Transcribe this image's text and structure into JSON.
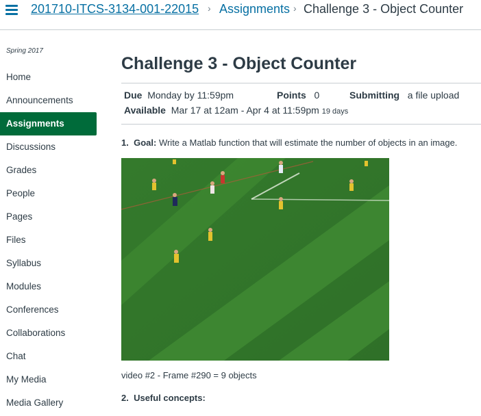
{
  "breadcrumb": {
    "course": "201710-ITCS-3134-001-22015",
    "assignments": "Assignments",
    "current": "Challenge 3 - Object Counter"
  },
  "sidebar": {
    "term": "Spring 2017",
    "items": [
      {
        "label": "Home",
        "active": false
      },
      {
        "label": "Announcements",
        "active": false
      },
      {
        "label": "Assignments",
        "active": true
      },
      {
        "label": "Discussions",
        "active": false
      },
      {
        "label": "Grades",
        "active": false
      },
      {
        "label": "People",
        "active": false
      },
      {
        "label": "Pages",
        "active": false
      },
      {
        "label": "Files",
        "active": false
      },
      {
        "label": "Syllabus",
        "active": false
      },
      {
        "label": "Modules",
        "active": false
      },
      {
        "label": "Conferences",
        "active": false
      },
      {
        "label": "Collaborations",
        "active": false
      },
      {
        "label": "Chat",
        "active": false
      },
      {
        "label": "My Media",
        "active": false
      },
      {
        "label": "Media Gallery",
        "active": false
      }
    ]
  },
  "assignment": {
    "title": "Challenge 3 - Object Counter",
    "due_label": "Due",
    "due_value": "Monday by 11:59pm",
    "points_label": "Points",
    "points_value": "0",
    "submitting_label": "Submitting",
    "submitting_value": "a file upload",
    "available_label": "Available",
    "available_value": "Mar 17 at 12am - Apr 4 at 11:59pm",
    "available_days": "19 days"
  },
  "content": {
    "goal_number": "1.",
    "goal_label": "Goal:",
    "goal_text": "Write a Matlab function that will estimate the number of objects in an image.",
    "image_caption": "video #2 - Frame #290 = 9 objects",
    "concepts_number": "2.",
    "concepts_label": "Useful concepts:"
  },
  "colors": {
    "link": "#0770a3",
    "active_nav": "#006b3a",
    "text": "#2d3b45",
    "field_green": "#3f8a32"
  }
}
